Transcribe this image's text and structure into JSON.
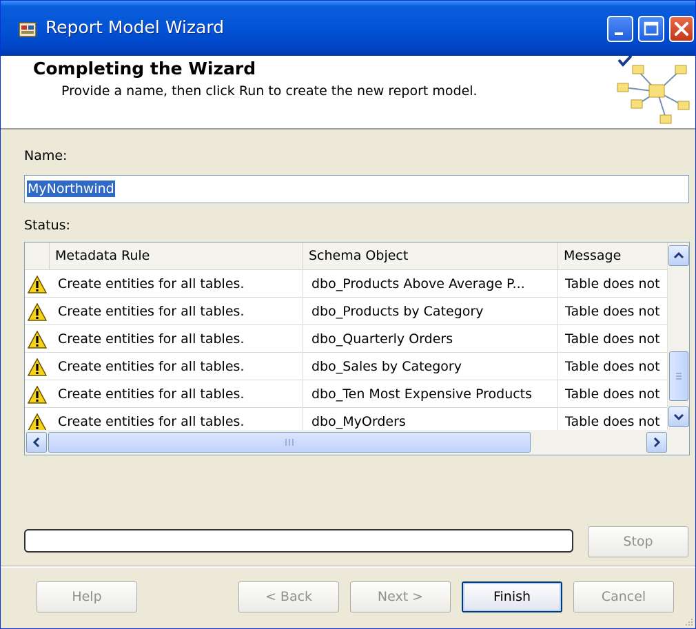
{
  "window": {
    "title": "Report Model Wizard",
    "icon": "wizard-app-icon",
    "controls": {
      "minimize": "minimize-icon",
      "maximize": "maximize-icon",
      "close": "close-icon"
    }
  },
  "header": {
    "title": "Completing the Wizard",
    "subtitle": "Provide a name, then click Run to create the new report model.",
    "graphic": "report-model-graphic"
  },
  "form": {
    "name_label": "Name:",
    "name_value": "MyNorthwind",
    "status_label": "Status:"
  },
  "grid": {
    "columns": [
      "Metadata Rule",
      "Schema Object",
      "Message"
    ],
    "rows": [
      {
        "icon": "warning-icon",
        "rule": "Create entities for all tables.",
        "object": "dbo_Products Above Average P...",
        "message": "Table does not"
      },
      {
        "icon": "warning-icon",
        "rule": "Create entities for all tables.",
        "object": "dbo_Products by Category",
        "message": "Table does not"
      },
      {
        "icon": "warning-icon",
        "rule": "Create entities for all tables.",
        "object": "dbo_Quarterly Orders",
        "message": "Table does not"
      },
      {
        "icon": "warning-icon",
        "rule": "Create entities for all tables.",
        "object": "dbo_Sales by Category",
        "message": "Table does not"
      },
      {
        "icon": "warning-icon",
        "rule": "Create entities for all tables.",
        "object": "dbo_Ten Most Expensive Products",
        "message": "Table does not"
      },
      {
        "icon": "warning-icon",
        "rule": "Create entities for all tables.",
        "object": "dbo_MyOrders",
        "message": "Table does not"
      }
    ]
  },
  "progress": {
    "value": 0
  },
  "buttons": {
    "stop": "Stop",
    "help": "Help",
    "back": "< Back",
    "next": "Next >",
    "finish": "Finish",
    "cancel": "Cancel"
  },
  "colors": {
    "titlebar": "#0453d6",
    "selection": "#316ac5",
    "window_bg": "#ece9d8",
    "warning": "#f5d31a"
  }
}
